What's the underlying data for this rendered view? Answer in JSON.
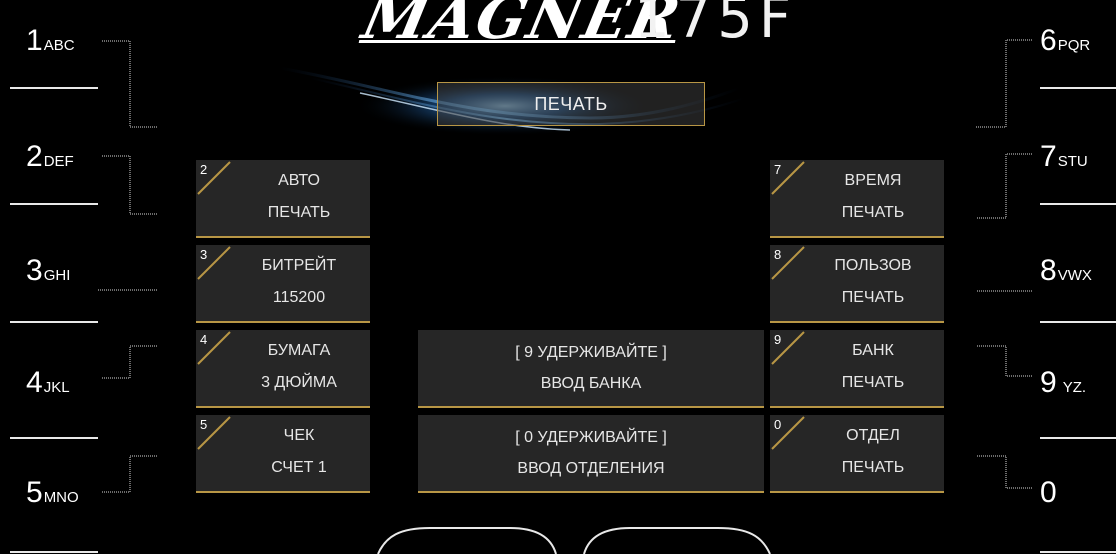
{
  "header": {
    "brand": "MAGNER",
    "model": "175F",
    "mode_label": "ПЕЧАТЬ"
  },
  "left_keys": [
    {
      "num": "1",
      "letters": "ABC"
    },
    {
      "num": "2",
      "letters": "DEF"
    },
    {
      "num": "3",
      "letters": "GHI"
    },
    {
      "num": "4",
      "letters": "JKL"
    },
    {
      "num": "5",
      "letters": "MNO"
    }
  ],
  "right_keys": [
    {
      "num": "6",
      "letters": "PQR"
    },
    {
      "num": "7",
      "letters": "STU"
    },
    {
      "num": "8",
      "letters": "VWX"
    },
    {
      "num": "9",
      "letters": "YZ."
    },
    {
      "num": "0",
      "letters": ""
    }
  ],
  "left_tiles": [
    {
      "digit": "2",
      "line1": "АВТО",
      "line2": "ПЕЧАТЬ"
    },
    {
      "digit": "3",
      "line1": "БИТРЕЙТ",
      "line2": "115200"
    },
    {
      "digit": "4",
      "line1": "БУМАГА",
      "line2": "3 ДЮЙМА"
    },
    {
      "digit": "5",
      "line1": "ЧЕК",
      "line2": "СЧЕТ 1"
    }
  ],
  "right_tiles": [
    {
      "digit": "7",
      "line1": "ВРЕМЯ",
      "line2": "ПЕЧАТЬ"
    },
    {
      "digit": "8",
      "line1": "ПОЛЬЗОВ",
      "line2": "ПЕЧАТЬ"
    },
    {
      "digit": "9",
      "line1": "БАНК",
      "line2": "ПЕЧАТЬ"
    },
    {
      "digit": "0",
      "line1": "ОТДЕЛ",
      "line2": "ПЕЧАТЬ"
    }
  ],
  "center_tiles": [
    {
      "line1": "[ 9 УДЕРЖИВАЙТЕ ]",
      "line2": "ВВОД БАНКА"
    },
    {
      "line1": "[ 0 УДЕРЖИВАЙТЕ ]",
      "line2": "ВВОД ОТДЕЛЕНИЯ"
    }
  ],
  "colors": {
    "background": "#000000",
    "tile": "#262626",
    "accent_gold": "#b89645",
    "text": "#e6e6e6",
    "glow_blue": "#4aa8ff"
  }
}
